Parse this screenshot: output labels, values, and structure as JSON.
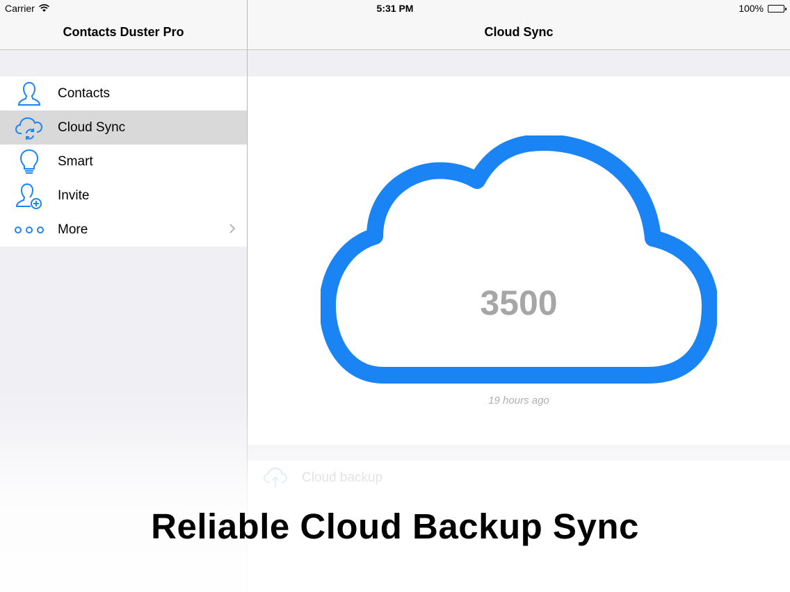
{
  "status_bar": {
    "carrier": "Carrier",
    "time": "5:31 PM",
    "battery": "100%"
  },
  "sidebar": {
    "title": "Contacts Duster Pro",
    "items": [
      {
        "label": "Contacts",
        "icon": "person-icon"
      },
      {
        "label": "Cloud Sync",
        "icon": "cloud-sync-icon",
        "selected": true
      },
      {
        "label": "Smart",
        "icon": "lightbulb-icon"
      },
      {
        "label": "Invite",
        "icon": "add-person-icon"
      },
      {
        "label": "More",
        "icon": "more-dots-icon"
      }
    ]
  },
  "main": {
    "title": "Cloud Sync",
    "count": "3500",
    "last_sync": "19 hours ago",
    "backup_label": "Cloud backup"
  },
  "caption": "Reliable Cloud Backup Sync",
  "colors": {
    "accent": "#1a84f5",
    "selected_row": "#d9d9d9",
    "muted_text": "#a6a6a6"
  }
}
